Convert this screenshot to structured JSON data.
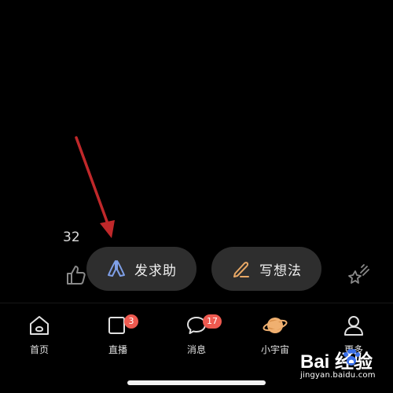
{
  "post": {
    "like_count": "32"
  },
  "actions": {
    "help_label": "发求助",
    "thought_label": "写想法"
  },
  "tabbar": {
    "items": [
      {
        "label": "首页",
        "icon": "home-icon",
        "badge": ""
      },
      {
        "label": "直播",
        "icon": "live-icon",
        "badge": "3"
      },
      {
        "label": "消息",
        "icon": "message-icon",
        "badge": "17"
      },
      {
        "label": "小宇宙",
        "icon": "planet-icon",
        "badge": ""
      },
      {
        "label": "更多",
        "icon": "profile-icon",
        "badge": ""
      }
    ]
  },
  "watermark": {
    "brand": "Bai  经验",
    "domain": "jingyan.baidu.com"
  },
  "colors": {
    "background": "#000000",
    "pill": "#2e2e2e",
    "badge": "#ee5a50",
    "help_icon": "#7fa0e8",
    "thought_icon": "#e8a866",
    "planet": "#f0b070",
    "arrow": "#c0282a"
  }
}
